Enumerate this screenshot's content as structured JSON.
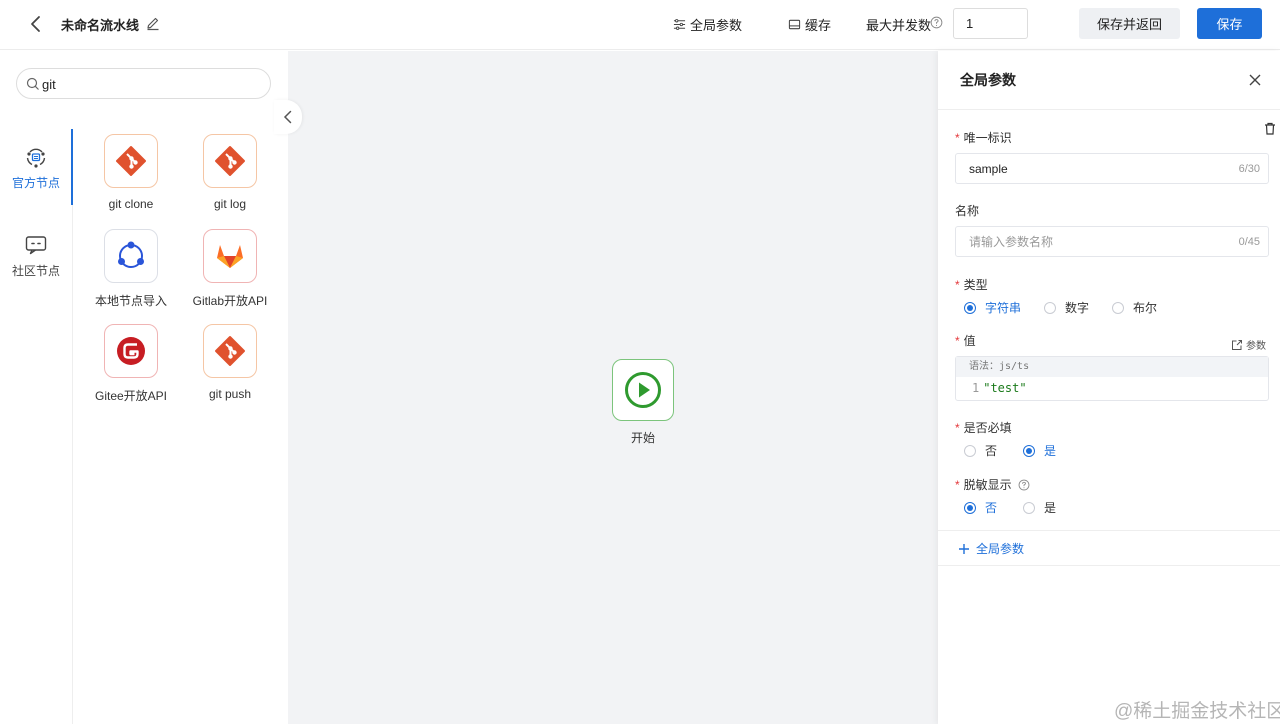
{
  "header": {
    "pipeline_name": "未命名流水线",
    "global_params_label": "全局参数",
    "cache_label": "缓存",
    "max_concurrency_label": "最大并发数",
    "max_concurrency_value": "1",
    "save_and_return_label": "保存并返回",
    "save_label": "保存"
  },
  "sidebar": {
    "search": {
      "value": "git"
    },
    "categories": [
      {
        "label": "官方节点",
        "icon": "official-node-icon",
        "active": true
      },
      {
        "label": "社区节点",
        "icon": "community-node-icon",
        "active": false
      }
    ],
    "nodes": [
      {
        "label": "git clone",
        "icon": "git-icon"
      },
      {
        "label": "git log",
        "icon": "git-icon"
      },
      {
        "label": "本地节点导入",
        "icon": "share-nodes-icon"
      },
      {
        "label": "Gitlab开放API",
        "icon": "gitlab-icon"
      },
      {
        "label": "Gitee开放API",
        "icon": "gitee-icon"
      },
      {
        "label": "git push",
        "icon": "git-icon"
      }
    ]
  },
  "canvas": {
    "start_node_label": "开始"
  },
  "drawer": {
    "title": "全局参数",
    "fields": {
      "ref": {
        "label": "唯一标识",
        "value": "sample",
        "counter": "6/30"
      },
      "name": {
        "label": "名称",
        "placeholder": "请输入参数名称",
        "counter": "0/45"
      },
      "type": {
        "label": "类型",
        "options": [
          "字符串",
          "数字",
          "布尔"
        ],
        "selected": "字符串"
      },
      "value": {
        "label": "值",
        "param_link": "参数",
        "hint": "语法：js/ts",
        "line_number": "1",
        "code": "\"test\""
      },
      "required": {
        "label": "是否必填",
        "options": [
          "否",
          "是"
        ],
        "selected": "是"
      },
      "masked": {
        "label": "脱敏显示",
        "options": [
          "否",
          "是"
        ],
        "selected": "否"
      }
    },
    "add_param_label": "全局参数"
  },
  "colors": {
    "primary": "#1e6fd9",
    "required": "#e4393c",
    "canvas_bg": "#f2f3f5",
    "start_green": "#2f9a2f"
  },
  "watermark": "@稀土掘金技术社区"
}
